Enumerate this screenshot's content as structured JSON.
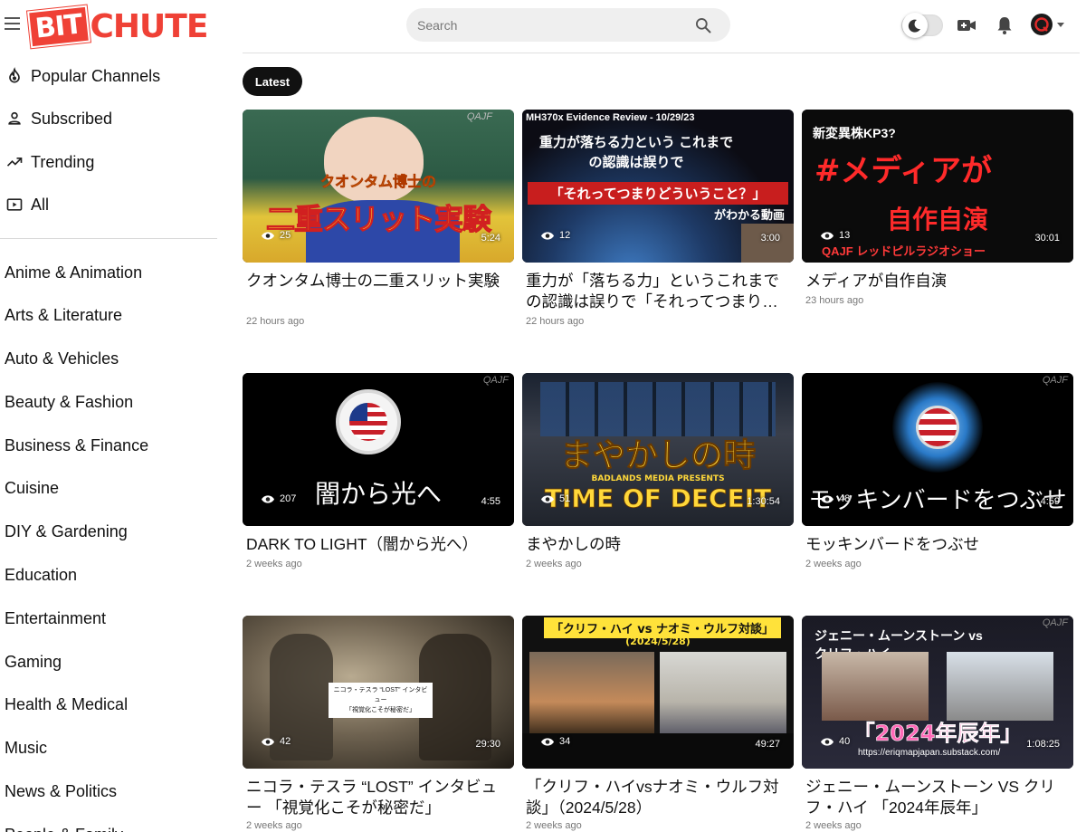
{
  "header": {
    "logo_left": "BIT",
    "logo_right": "CHUTE",
    "search_placeholder": "Search",
    "icons": [
      "menu-icon",
      "search-icon",
      "theme-toggle",
      "video-camera-icon",
      "bell-icon",
      "user-avatar",
      "caret-down-icon"
    ]
  },
  "sidebar": {
    "nav": [
      {
        "label": "Popular Channels",
        "icon": "flame-icon"
      },
      {
        "label": "Subscribed",
        "icon": "person-icon"
      },
      {
        "label": "Trending",
        "icon": "trending-up-icon"
      },
      {
        "label": "All",
        "icon": "play-box-icon"
      }
    ],
    "categories": [
      "Anime & Animation",
      "Arts & Literature",
      "Auto & Vehicles",
      "Beauty & Fashion",
      "Business & Finance",
      "Cuisine",
      "DIY & Gardening",
      "Education",
      "Entertainment",
      "Gaming",
      "Health & Medical",
      "Music",
      "News & Politics",
      "People & Family"
    ]
  },
  "tabs": {
    "latest": "Latest"
  },
  "videos": [
    {
      "title": "クオンタム博士の二重スリット実験",
      "views": "25",
      "duration": "5:24",
      "age": "22 hours ago",
      "thumb_text": "二重スリット実験",
      "thumb_sub": "クオンタム博士の",
      "watermark": "QAJF"
    },
    {
      "title": "重力が「落ちる力」というこれまでの認識は誤りで「それってつまりどういうこと？」がわかる動画",
      "views": "12",
      "duration": "3:00",
      "age": "22 hours ago",
      "thumb_text": "「それってつまりどういうこと？」",
      "thumb_sub": "重力が落ちる力という これまでの認識は誤りで",
      "thumb_top": "MH370x Evidence Review - 10/29/23",
      "thumb_bottom": "がわかる動画"
    },
    {
      "title": "メディアが自作自演",
      "views": "13",
      "duration": "30:01",
      "age": "23 hours ago",
      "thumb_text": "#メディアが",
      "thumb_sub": "自作自演",
      "thumb_top": "新変異株KP3?",
      "thumb_bottom": "QAJF  レッドピルラジオショー"
    },
    {
      "title": "DARK TO LIGHT（闇から光へ）",
      "views": "207",
      "duration": "4:55",
      "age": "2 weeks ago",
      "thumb_text": "闇から光へ",
      "watermark": "QAJF"
    },
    {
      "title": "まやかしの時",
      "views": "51",
      "duration": "1:30:54",
      "age": "2 weeks ago",
      "thumb_text": "まやかしの時",
      "thumb_sub": "TIME OF DECEIT",
      "thumb_top": "BADLANDS MEDIA PRESENTS"
    },
    {
      "title": "モッキンバードをつぶせ",
      "views": "48",
      "duration": "4:59",
      "age": "2 weeks ago",
      "thumb_text": "モッキンバードをつぶせ",
      "watermark": "QAJF"
    },
    {
      "title": "ニコラ・テスラ “LOST” インタビュー 「視覚化こそが秘密だ」",
      "views": "42",
      "duration": "29:30",
      "age": "2 weeks ago",
      "thumb_text": "ニコラ・テスラ “LOST” インタビュー",
      "thumb_sub": "「視覚化こそが秘密だ」"
    },
    {
      "title": "「クリフ・ハイvsナオミ・ウルフ対談」（2024/5/28）",
      "views": "34",
      "duration": "49:27",
      "age": "2 weeks ago",
      "thumb_text": "「クリフ・ハイ vs ナオミ・ウルフ対談」",
      "thumb_sub": "(2024/5/28)"
    },
    {
      "title": "ジェニー・ムーンストーン VS クリフ・ハイ 「2024年辰年」",
      "views": "40",
      "duration": "1:08:25",
      "age": "2 weeks ago",
      "thumb_text": "「2024年辰年」",
      "thumb_sub": "ジェニー・ムーンストーン vs クリフ・ハイ",
      "thumb_bottom": "https://eriqmapjapan.substack.com/",
      "watermark": "QAJF"
    }
  ],
  "colors": {
    "brand": "#ef4136",
    "tab_bg": "#111111",
    "search_bg": "#efefef"
  }
}
